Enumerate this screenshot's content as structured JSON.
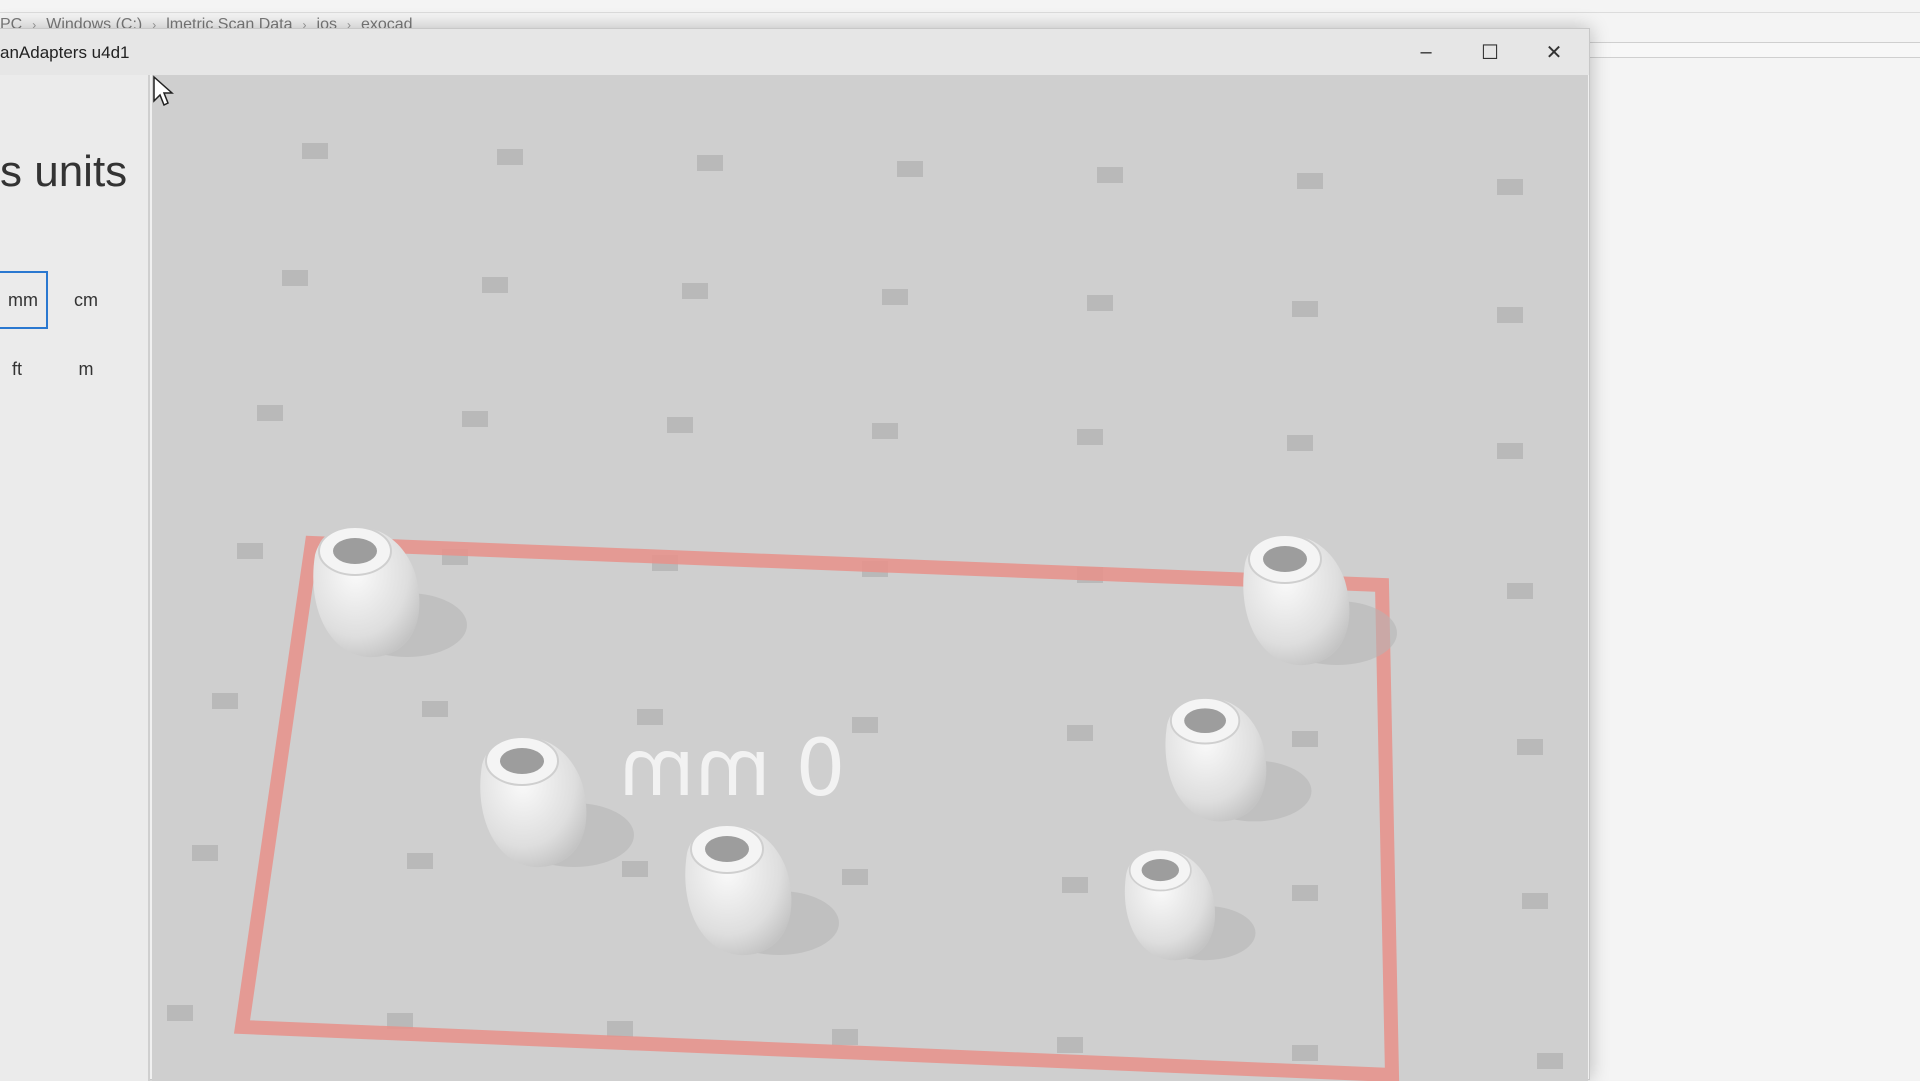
{
  "explorer": {
    "breadcrumb": [
      "PC",
      "Windows (C:)",
      "lmetric Scan Data",
      "ios",
      "exocad"
    ]
  },
  "window": {
    "title": "anAdapters u4d1",
    "controls": {
      "minimize": "–",
      "maximize": "☐",
      "close": "✕"
    }
  },
  "sidebar": {
    "heading": "s units",
    "units": {
      "mm": "mm",
      "cm": "cm",
      "ft": "ft",
      "m": "m"
    },
    "selected_unit": "mm"
  },
  "viewport": {
    "readout": "0 mm",
    "build_plate_color": "#e8908a",
    "object_count": 6
  }
}
